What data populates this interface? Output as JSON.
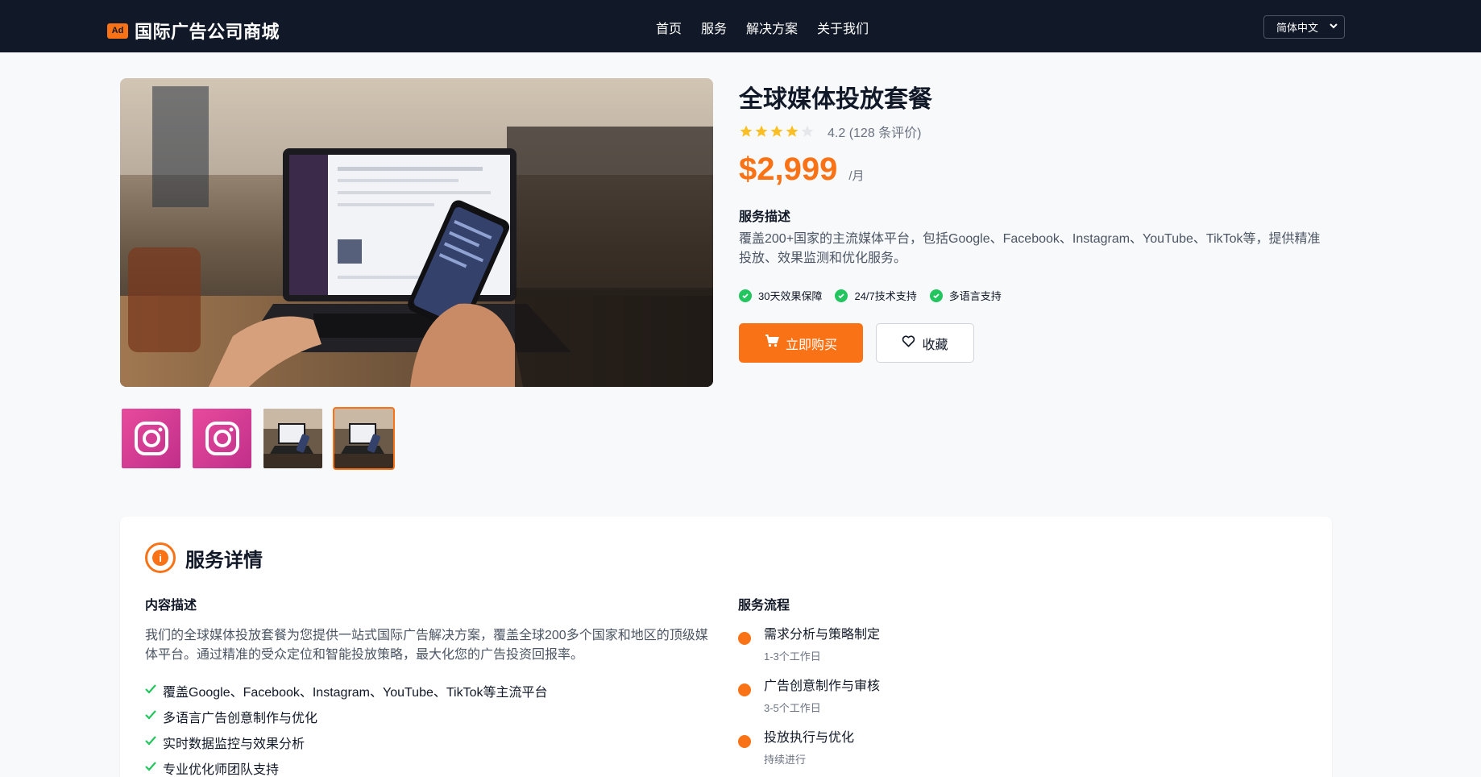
{
  "header": {
    "logo_badge": "Ad",
    "site_name": "国际广告公司商城",
    "nav": [
      "首页",
      "服务",
      "解决方案",
      "关于我们"
    ],
    "language": "简体中文"
  },
  "product": {
    "title": "全球媒体投放套餐",
    "rating": 4.2,
    "rating_text": "4.2 (128 条评价)",
    "price": "$2,999",
    "price_unit": "/月",
    "desc_heading": "服务描述",
    "description": "覆盖200+国家的主流媒体平台，包括Google、Facebook、Instagram、YouTube、TikTok等，提供精准投放、效果监测和优化服务。",
    "features": [
      "30天效果保障",
      "24/7技术支持",
      "多语言支持"
    ],
    "buy_label": "立即购买",
    "fav_label": "收藏"
  },
  "details": {
    "title": "服务详情",
    "content_heading": "内容描述",
    "content_text": "我们的全球媒体投放套餐为您提供一站式国际广告解决方案，覆盖全球200多个国家和地区的顶级媒体平台。通过精准的受众定位和智能投放策略，最大化您的广告投资回报率。",
    "content_points": [
      "覆盖Google、Facebook、Instagram、YouTube、TikTok等主流平台",
      "多语言广告创意制作与优化",
      "实时数据监控与效果分析",
      "专业优化师团队支持"
    ],
    "process_heading": "服务流程",
    "steps": [
      {
        "title": "需求分析与策略制定",
        "sub": "1-3个工作日"
      },
      {
        "title": "广告创意制作与审核",
        "sub": "3-5个工作日"
      },
      {
        "title": "投放执行与优化",
        "sub": "持续进行"
      }
    ]
  },
  "colors": {
    "accent": "#f97316",
    "header_bg": "#111827",
    "success": "#22c55e",
    "star": "#fbbf24"
  }
}
